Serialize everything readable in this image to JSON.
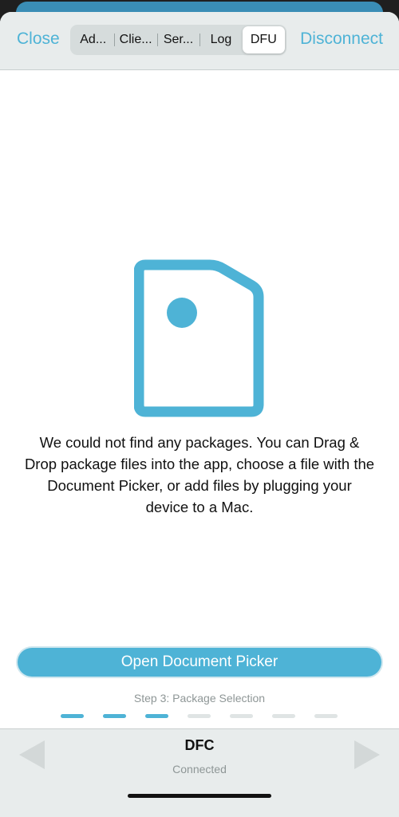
{
  "nav": {
    "close_label": "Close",
    "disconnect_label": "Disconnect",
    "segments": [
      "Ad...",
      "Clie...",
      "Ser...",
      "Log",
      "DFU"
    ],
    "selected_segment": "DFU"
  },
  "main": {
    "illustration_icon": "document-file-icon",
    "message": "We could not find any packages. You can Drag & Drop package files into the app, choose a file with the Document Picker, or add files by plugging your device to a Mac.",
    "open_picker_label": "Open Document Picker",
    "step_label": "Step 3: Package Selection",
    "steps_total": 7,
    "steps_completed": 3
  },
  "toolbar": {
    "title": "DFC",
    "status": "Connected",
    "prev_icon": "triangle-left-icon",
    "next_icon": "triangle-right-icon"
  },
  "colors": {
    "accent": "#4eb3d6",
    "bar_background": "#e8ecec",
    "inactive_step": "#dfe4e4",
    "disabled_arrow": "#d3d8d8"
  }
}
